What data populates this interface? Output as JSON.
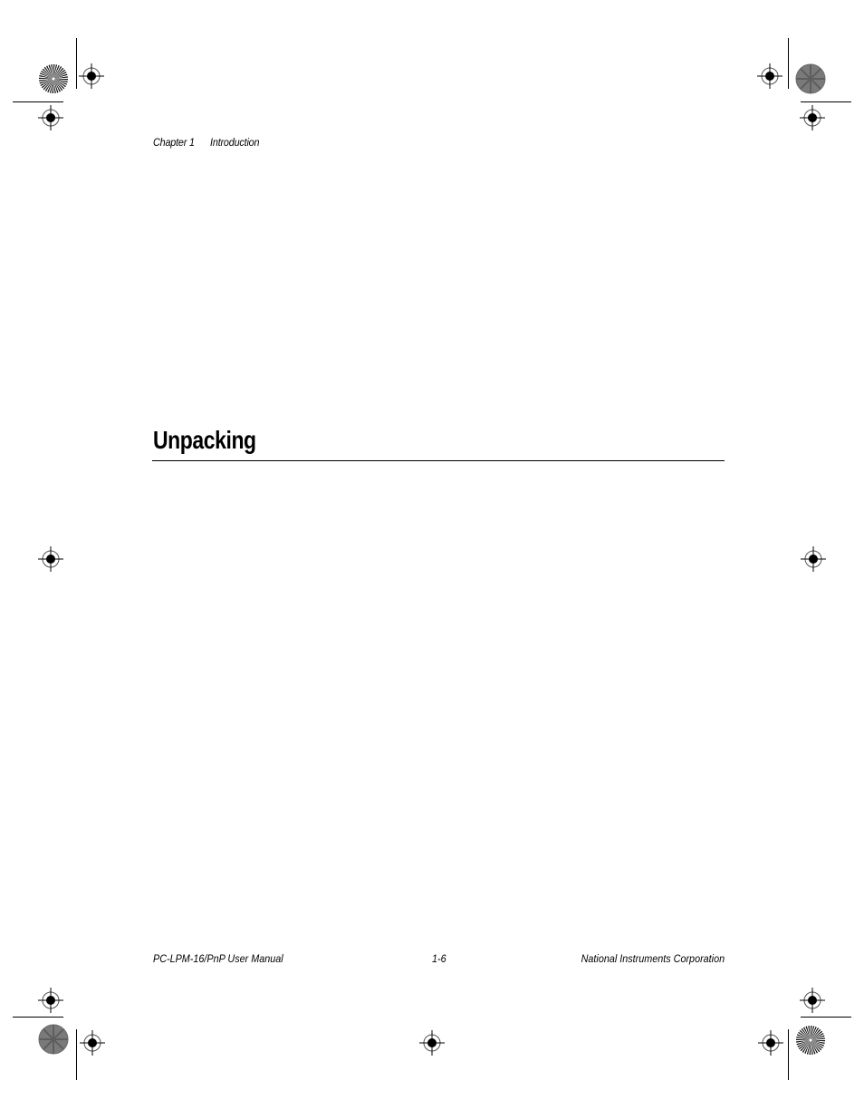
{
  "header": {
    "chapter_label": "Chapter 1",
    "chapter_title": "Introduction"
  },
  "section": {
    "heading": "Unpacking"
  },
  "footer": {
    "manual_title": "PC-LPM-16/PnP User Manual",
    "page_number": "1-6",
    "publisher": "National Instruments Corporation"
  },
  "print_marks": {
    "registration_marks": 9,
    "starburst_targets": 2,
    "gray_targets": 2,
    "crop_marks": 4
  }
}
